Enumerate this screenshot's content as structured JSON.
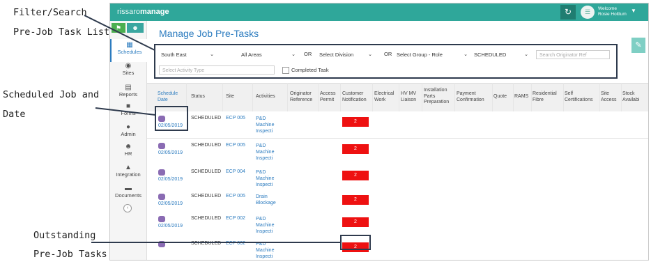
{
  "annotations": {
    "filter": [
      "Filter/Search",
      "Pre-Job Task List"
    ],
    "scheduled": [
      "Scheduled Job and",
      "Date"
    ],
    "outstanding": [
      "Outstanding",
      "Pre-Job Tasks"
    ]
  },
  "app": {
    "brand_prefix": "rissaro",
    "brand_name": "manage",
    "welcome": "Welcome",
    "user": "Rosie Holttum",
    "page_title": "Manage Job Pre-Tasks"
  },
  "sidebar": {
    "items": [
      {
        "label": "Schedules",
        "icon": "calendar-icon"
      },
      {
        "label": "Sites",
        "icon": "globe-icon"
      },
      {
        "label": "Reports",
        "icon": "bar-chart-icon"
      },
      {
        "label": "Forms",
        "icon": "document-icon"
      },
      {
        "label": "Admin",
        "icon": "user-icon"
      },
      {
        "label": "HR",
        "icon": "people-icon"
      },
      {
        "label": "Integration",
        "icon": "upload-icon"
      },
      {
        "label": "Documents",
        "icon": "folder-icon"
      }
    ]
  },
  "filters": {
    "region": "South East",
    "area": "All Areas",
    "or1": "OR",
    "division": "Select Division",
    "or2": "OR",
    "group_role": "Select Group - Role",
    "status": "SCHEDULED",
    "originator_placeholder": "Search Originator Ref",
    "activity_placeholder": "Select Activity Type",
    "completed_label": "Completed Task"
  },
  "table": {
    "headers": {
      "schedule_date": [
        "Schedule",
        "Date"
      ],
      "status": [
        "Status"
      ],
      "site": [
        "Site"
      ],
      "activities": [
        "Activities"
      ],
      "originator": [
        "Originator",
        "Reference"
      ],
      "access": [
        "Access",
        "Permit"
      ],
      "customer": [
        "Customer",
        "Notification"
      ],
      "electrical": [
        "Electrical",
        "Work"
      ],
      "hvmv": [
        "HV MV",
        "Liaison"
      ],
      "installation": [
        "Installation",
        "Parts",
        "Preparation"
      ],
      "payment": [
        "Payment",
        "Confirmation"
      ],
      "quote": [
        "Quote"
      ],
      "rams": [
        "RAMS"
      ],
      "residential": [
        "Residential",
        "Fibre"
      ],
      "self_cert": [
        "Self",
        "Certifications"
      ],
      "site_access": [
        "Site",
        "Access"
      ],
      "stock": [
        "Stock",
        "Availabi"
      ]
    },
    "rows": [
      {
        "date": "02/05/2019",
        "status": "SCHEDULED",
        "site": "ECP 005",
        "activity": [
          "P&D",
          "Machine",
          "Inspecti"
        ],
        "customer": "2"
      },
      {
        "date": "02/05/2019",
        "status": "SCHEDULED",
        "site": "ECP 005",
        "activity": [
          "P&D",
          "Machine",
          "Inspecti"
        ],
        "customer": "2"
      },
      {
        "date": "02/05/2019",
        "status": "SCHEDULED",
        "site": "ECP 004",
        "activity": [
          "P&D",
          "Machine",
          "Inspecti"
        ],
        "customer": "2"
      },
      {
        "date": "02/05/2019",
        "status": "SCHEDULED",
        "site": "ECP 005",
        "activity": [
          "Drain",
          "Blockage"
        ],
        "customer": "2"
      },
      {
        "date": "02/05/2019",
        "status": "SCHEDULED",
        "site": "ECP 002",
        "activity": [
          "P&D",
          "Machine",
          "Inspecti"
        ],
        "customer": "2"
      },
      {
        "date": "",
        "status": "SCHEDULED",
        "site": "ECP 002",
        "activity": [
          "P&D",
          "Machine",
          "Inspecti"
        ],
        "customer": "2"
      }
    ]
  },
  "colors": {
    "topbar": "#2fa79a",
    "link": "#2b7bbf",
    "badge": "#ee1111",
    "calendar": "#8a6bb3"
  }
}
